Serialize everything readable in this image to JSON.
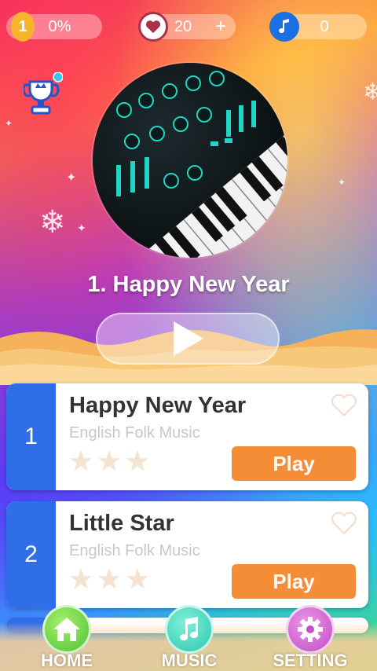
{
  "status_bar": {
    "level": "1",
    "progress": "0%",
    "hearts": "20",
    "hearts_add": "+",
    "notes": "0"
  },
  "now_playing": {
    "title": "1. Happy New Year"
  },
  "songs": [
    {
      "number": "1",
      "title": "Happy New Year",
      "artist": "English Folk Music",
      "stars": 0,
      "play_label": "Play"
    },
    {
      "number": "2",
      "title": "Little Star",
      "artist": "English Folk Music",
      "stars": 0,
      "play_label": "Play"
    }
  ],
  "nav": {
    "home": "HOME",
    "music": "MUSIC",
    "setting": "SETTING"
  },
  "colors": {
    "accent_orange": "#f58c36",
    "card_blue": "#2f6ee8",
    "star_inactive": "#f3e3d0"
  }
}
